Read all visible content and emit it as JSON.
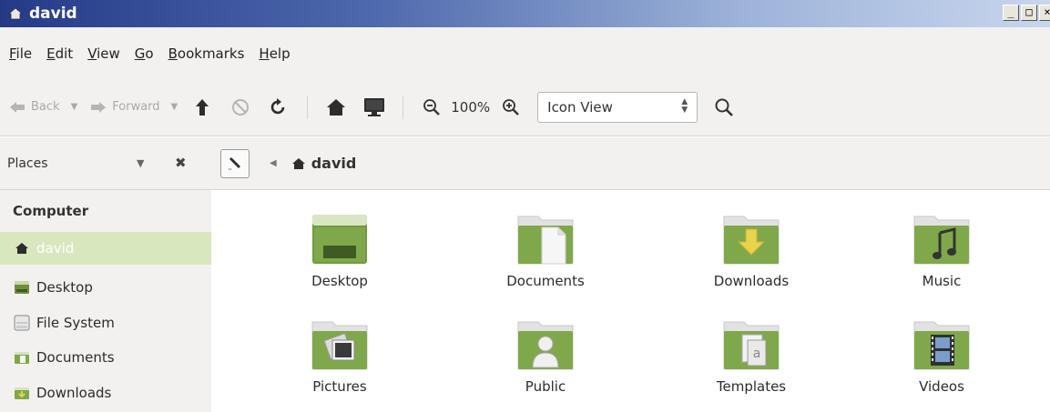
{
  "window": {
    "title": "david",
    "controls": {
      "minimize": "_",
      "maximize": "□",
      "close": "×"
    }
  },
  "menubar": {
    "items": [
      {
        "label": "File",
        "mnemonic": "F",
        "rest": "ile"
      },
      {
        "label": "Edit",
        "mnemonic": "E",
        "rest": "dit"
      },
      {
        "label": "View",
        "mnemonic": "V",
        "rest": "iew"
      },
      {
        "label": "Go",
        "mnemonic": "G",
        "rest": "o"
      },
      {
        "label": "Bookmarks",
        "mnemonic": "B",
        "rest": "ookmarks"
      },
      {
        "label": "Help",
        "mnemonic": "H",
        "rest": "elp"
      }
    ]
  },
  "toolbar": {
    "back_label": "Back",
    "forward_label": "Forward",
    "zoom_level": "100%",
    "view_mode": "Icon View",
    "icons": {
      "back": "arrow-left-icon",
      "forward": "arrow-right-icon",
      "up": "arrow-up-icon",
      "stop": "stop-icon",
      "reload": "reload-icon",
      "home": "home-icon",
      "computer": "computer-icon",
      "zoom_out": "zoom-out-icon",
      "zoom_in": "zoom-in-icon",
      "search": "search-icon"
    }
  },
  "sidebar": {
    "header": "Places",
    "section": "Computer",
    "items": [
      {
        "label": "david",
        "icon": "home-icon",
        "selected": true
      },
      {
        "label": "Desktop",
        "icon": "desktop-icon",
        "selected": false
      },
      {
        "label": "File System",
        "icon": "drive-icon",
        "selected": false
      },
      {
        "label": "Documents",
        "icon": "folder-icon",
        "selected": false
      },
      {
        "label": "Downloads",
        "icon": "folder-download-icon",
        "selected": false
      }
    ]
  },
  "location": {
    "crumb": "david"
  },
  "files": [
    {
      "name": "Desktop",
      "icon": "desktop-folder-icon"
    },
    {
      "name": "Documents",
      "icon": "documents-folder-icon"
    },
    {
      "name": "Downloads",
      "icon": "downloads-folder-icon"
    },
    {
      "name": "Music",
      "icon": "music-folder-icon"
    },
    {
      "name": "Pictures",
      "icon": "pictures-folder-icon"
    },
    {
      "name": "Public",
      "icon": "public-folder-icon"
    },
    {
      "name": "Templates",
      "icon": "templates-folder-icon"
    },
    {
      "name": "Videos",
      "icon": "videos-folder-icon"
    }
  ],
  "colors": {
    "folder_green": "#7fa84a",
    "folder_dark": "#5c8a35",
    "selection": "#d8e7bd",
    "titlebar": "#243a87"
  }
}
